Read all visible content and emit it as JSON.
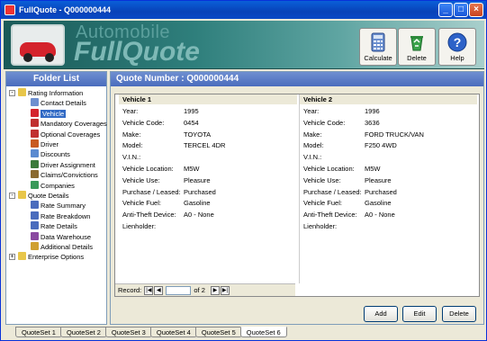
{
  "window": {
    "title": "FullQuote - Q000000444",
    "min_label": "_",
    "max_label": "□",
    "close_label": "×"
  },
  "banner": {
    "logo_line1": "Automobile",
    "logo_line2": "FullQuote"
  },
  "toolbar": {
    "calculate_label": "Calculate",
    "delete_label": "Delete",
    "help_label": "Help"
  },
  "folder_list": {
    "title": "Folder List",
    "items": [
      {
        "label": "Rating Information",
        "icon": "folder-open-icon"
      },
      {
        "label": "Contact Details",
        "icon": "contact-icon"
      },
      {
        "label": "Vehicle",
        "icon": "car-icon"
      },
      {
        "label": "Mandatory Coverages",
        "icon": "umbrella-icon"
      },
      {
        "label": "Optional Coverages",
        "icon": "umbrella-icon"
      },
      {
        "label": "Driver",
        "icon": "driver-icon"
      },
      {
        "label": "Discounts",
        "icon": "discount-icon"
      },
      {
        "label": "Driver Assignment",
        "icon": "assign-icon"
      },
      {
        "label": "Claims/Convictions",
        "icon": "claims-icon"
      },
      {
        "label": "Companies",
        "icon": "companies-icon"
      },
      {
        "label": "Quote Details",
        "icon": "folder-open-icon"
      },
      {
        "label": "Rate Summary",
        "icon": "rate-icon"
      },
      {
        "label": "Rate Breakdown",
        "icon": "rate-icon"
      },
      {
        "label": "Rate Details",
        "icon": "rate-icon"
      },
      {
        "label": "Data Warehouse",
        "icon": "warehouse-icon"
      },
      {
        "label": "Additional Details",
        "icon": "details-icon"
      },
      {
        "label": "Enterprise Options",
        "icon": "folder-icon"
      }
    ]
  },
  "quote": {
    "header": "Quote Number : Q000000444",
    "vehicles": [
      {
        "title": "Vehicle 1",
        "fields": [
          {
            "label": "Year:",
            "value": "1995"
          },
          {
            "label": "Vehicle Code:",
            "value": "0454"
          },
          {
            "label": "Make:",
            "value": "TOYOTA"
          },
          {
            "label": "Model:",
            "value": "TERCEL 4DR"
          },
          {
            "label": "V.I.N.:",
            "value": ""
          },
          {
            "label": "Vehicle Location:",
            "value": "M5W"
          },
          {
            "label": "Vehicle Use:",
            "value": "Pleasure"
          },
          {
            "label": "Purchase / Leased:",
            "value": "Purchased"
          },
          {
            "label": "Vehicle Fuel:",
            "value": "Gasoline"
          },
          {
            "label": "Anti-Theft Device:",
            "value": "A0 - None"
          },
          {
            "label": "Lienholder:",
            "value": ""
          }
        ]
      },
      {
        "title": "Vehicle 2",
        "fields": [
          {
            "label": "Year:",
            "value": "1996"
          },
          {
            "label": "Vehicle Code:",
            "value": "3636"
          },
          {
            "label": "Make:",
            "value": "FORD TRUCK/VAN"
          },
          {
            "label": "Model:",
            "value": "F250 4WD"
          },
          {
            "label": "V.I.N.:",
            "value": ""
          },
          {
            "label": "Vehicle Location:",
            "value": "M5W"
          },
          {
            "label": "Vehicle Use:",
            "value": "Pleasure"
          },
          {
            "label": "Purchase / Leased:",
            "value": "Purchased"
          },
          {
            "label": "Vehicle Fuel:",
            "value": "Gasoline"
          },
          {
            "label": "Anti-Theft Device:",
            "value": "A0 - None"
          },
          {
            "label": "Lienholder:",
            "value": ""
          }
        ]
      }
    ],
    "record": {
      "label": "Record:",
      "current": "",
      "of_text": "of 2"
    },
    "actions": {
      "add_label": "Add",
      "edit_label": "Edit",
      "delete_label": "Delete"
    }
  },
  "tabs": [
    "QuoteSet 1",
    "QuoteSet 2",
    "QuoteSet 3",
    "QuoteSet 4",
    "QuoteSet 5",
    "QuoteSet 6"
  ],
  "active_tab": "QuoteSet 6",
  "colors": {
    "title_bar": "#0842b8",
    "panel_header": "#4a6cbd",
    "selection": "#316ac5",
    "banner": "#2f7f7c"
  }
}
